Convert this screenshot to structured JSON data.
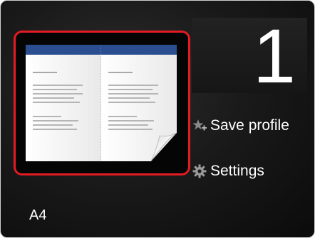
{
  "copies": {
    "value": "1"
  },
  "preview": {
    "layout": "two-page book spread with page curl",
    "selected": true,
    "highlight_color": "#e31b23",
    "header_color": "#2a4e8f"
  },
  "menu": {
    "save_profile": {
      "label": "Save profile",
      "icon": "star-plus-icon"
    },
    "settings": {
      "label": "Settings",
      "icon": "gear-icon"
    }
  },
  "paper": {
    "size": "A4"
  }
}
